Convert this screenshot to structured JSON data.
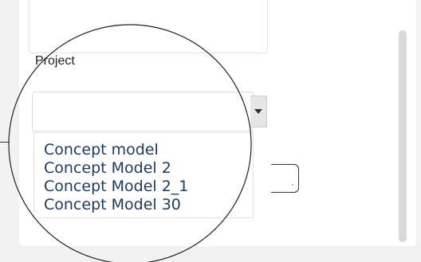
{
  "form": {
    "project_label": "Project",
    "project_select_value": ""
  },
  "dropdown": {
    "options": [
      "Concept model",
      "Concept Model 2",
      "Concept Model 2_1",
      "Concept Model 30"
    ]
  },
  "icons": {
    "select_arrow": "chevron-down-icon"
  },
  "colors": {
    "background": "#f2f2f2",
    "panel": "#ffffff",
    "option_text": "#1e3a5a",
    "scrollbar": "#d9d9d9"
  }
}
